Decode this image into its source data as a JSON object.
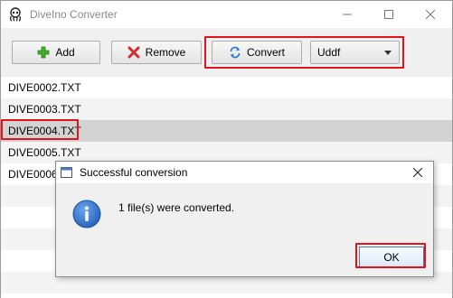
{
  "window": {
    "title": "DiveIno Converter"
  },
  "toolbar": {
    "add_label": "Add",
    "remove_label": "Remove",
    "convert_label": "Convert",
    "format_selected": "Uddf"
  },
  "files": [
    {
      "name": "DIVE0002.TXT",
      "selected": false
    },
    {
      "name": "DIVE0003.TXT",
      "selected": false
    },
    {
      "name": "DIVE0004.TXT",
      "selected": true
    },
    {
      "name": "DIVE0005.TXT",
      "selected": false
    },
    {
      "name": "DIVE0006",
      "selected": false
    }
  ],
  "dialog": {
    "title": "Successful conversion",
    "message": "1 file(s) were converted.",
    "ok_label": "OK"
  },
  "colors": {
    "highlight": "#e0141e",
    "info_icon": "#2f6fc7",
    "selected_row": "#d3d3d3"
  },
  "icons": {
    "app": "octopus-icon",
    "add": "green-plus-icon",
    "remove": "red-x-icon",
    "convert": "refresh-arrows-icon",
    "dialog_info": "info-icon"
  }
}
